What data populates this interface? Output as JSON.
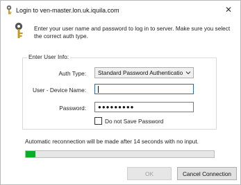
{
  "window": {
    "title": "Login to ven-master.lon.uk.iquila.com",
    "close_glyph": "✕",
    "title_icon": "key-icon"
  },
  "intro": {
    "icon": "key-icon",
    "text": "Enter your user name and password to log in to server. Make sure you select the correct auth type."
  },
  "user_info": {
    "legend": "Enter User Info:",
    "auth_type_label": "Auth Type:",
    "auth_type_value": "Standard Password Authenticatio",
    "user_label": "User - Device Name:",
    "user_value": "",
    "password_label": "Password:",
    "password_mask": "●●●●●●●●●",
    "no_save_label": "Do not Save Password",
    "no_save_checked": false
  },
  "status": {
    "text": "Automatic reconnection will be made after 14 seconds with no input.",
    "progress": 0.05
  },
  "buttons": {
    "ok_label": "OK",
    "cancel_label": "Cancel Connection"
  },
  "colors": {
    "progress_fill": "#06b025",
    "focus_border": "#0078d7"
  }
}
